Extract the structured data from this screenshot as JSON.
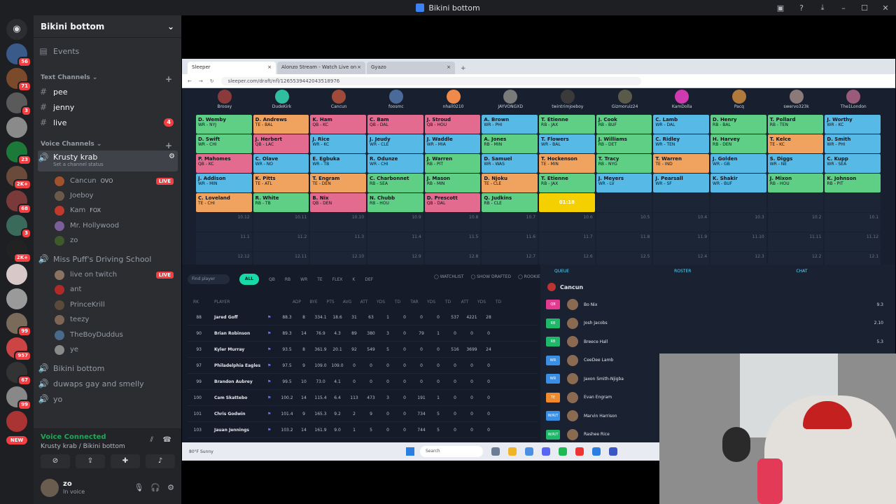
{
  "window": {
    "title": "Bikini bottom"
  },
  "rail": {
    "badges": [
      "56",
      "71",
      "3",
      "23",
      "2K+",
      "68",
      "3",
      "2K+",
      "99",
      "957",
      "67",
      "99"
    ],
    "new_label": "NEW"
  },
  "guild": {
    "name": "Bikini bottom"
  },
  "channels": {
    "events": "Events",
    "text_category": "Text Channels",
    "text": [
      {
        "name": "pee"
      },
      {
        "name": "jenny"
      },
      {
        "name": "live",
        "badge": "4"
      }
    ],
    "voice_category": "Voice Channels",
    "krusty": {
      "name": "Krusty krab",
      "status_hint": "Set a channel status",
      "users": [
        {
          "name": "Cancun",
          "extra": "OVO",
          "live": "LIVE",
          "color": "#a0522d"
        },
        {
          "name": "Joeboy",
          "color": "#6b5a4a"
        },
        {
          "name": "Kam",
          "extra": "FOX",
          "color": "#c0392b"
        },
        {
          "name": "Mr. Hollywood",
          "color": "#7b5e9a"
        },
        {
          "name": "zo",
          "color": "#3e5a2b"
        }
      ]
    },
    "puffs": {
      "name": "Miss Puff's Driving School",
      "users": [
        {
          "name": "live on twitch",
          "live": "LIVE",
          "color": "#8a7360"
        },
        {
          "name": "ant",
          "color": "#b02a2a"
        },
        {
          "name": "PrinceKrill",
          "color": "#5a4a3a"
        },
        {
          "name": "teezy",
          "color": "#7d6655"
        },
        {
          "name": "TheBoyDuddus",
          "color": "#4a6a8a"
        },
        {
          "name": "ye",
          "color": "#8a8a8a"
        }
      ]
    },
    "voice_more": [
      "Bikini bottom",
      "duwaps gay and smelly",
      "yo"
    ]
  },
  "voice_panel": {
    "title": "Voice Connected",
    "sub": "Krusty krab / Bikini bottom"
  },
  "user_panel": {
    "name": "zo",
    "status": "In voice"
  },
  "browser": {
    "tabs": [
      {
        "label": "Sleeper"
      },
      {
        "label": "Alonzo Stream - Watch Live on"
      },
      {
        "label": "Gyazo"
      }
    ],
    "url": "sleeper.com/draft/nfl/1265539442043518976"
  },
  "draft": {
    "teams": [
      "Brooxy",
      "DudeKirk",
      "Cancun",
      "foosmc",
      "nhall0210",
      "JAYVONGXD",
      "twintrimjoeboy",
      "Gizmoruiz24",
      "KamDolla",
      "Pacq",
      "swervo323k",
      "The1London"
    ],
    "rows": [
      [
        [
          "D. Wemby",
          "WR - NYJ",
          "rb"
        ],
        [
          "D. Andrews",
          "TE - BAL",
          "te"
        ],
        [
          "K. Ham",
          "QB - KC",
          "qb"
        ],
        [
          "C. Bam",
          "QB - DAL",
          "qb"
        ],
        [
          "J. Stroud",
          "QB - HOU",
          "qb"
        ],
        [
          "A. Brown",
          "WR - PHI",
          "wr"
        ],
        [
          "T. Etienne",
          "RB - JAX",
          "rb"
        ],
        [
          "J. Cook",
          "RB - BUF",
          "rb"
        ],
        [
          "C. Lamb",
          "WR - DAL",
          "wr"
        ],
        [
          "D. Henry",
          "RB - BAL",
          "rb"
        ],
        [
          "T. Pollard",
          "RB - TEN",
          "rb"
        ],
        [
          "J. Worthy",
          "WR - KC",
          "wr"
        ]
      ],
      [
        [
          "D. Swift",
          "WR - CHI",
          "rb"
        ],
        [
          "J. Herbert",
          "QB - LAC",
          "qb"
        ],
        [
          "J. Rice",
          "WR - KC",
          "wr"
        ],
        [
          "J. Jeudy",
          "WR - CLE",
          "wr"
        ],
        [
          "J. Waddle",
          "WR - MIA",
          "wr"
        ],
        [
          "A. Jones",
          "RB - MIN",
          "rb"
        ],
        [
          "T. Flowers",
          "WR - BAL",
          "wr"
        ],
        [
          "J. Williams",
          "RB - DET",
          "rb"
        ],
        [
          "C. Ridley",
          "WR - TEN",
          "wr"
        ],
        [
          "H. Harvey",
          "RB - DEN",
          "rb"
        ],
        [
          "T. Kelce",
          "TE - KC",
          "te"
        ],
        [
          "D. Smith",
          "WR - PHI",
          "wr"
        ]
      ],
      [
        [
          "P. Mahomes",
          "QB - KC",
          "qb"
        ],
        [
          "C. Olave",
          "WR - NO",
          "wr"
        ],
        [
          "E. Egbuka",
          "WR - TB",
          "wr"
        ],
        [
          "R. Odunze",
          "WR - CHI",
          "wr"
        ],
        [
          "J. Warren",
          "RB - PIT",
          "rb"
        ],
        [
          "D. Samuel",
          "WR - WAS",
          "wr"
        ],
        [
          "T. Hockenson",
          "TE - MIN",
          "te"
        ],
        [
          "T. Tracy",
          "RB - NYG",
          "rb"
        ],
        [
          "T. Warren",
          "TE - IND",
          "te"
        ],
        [
          "J. Golden",
          "WR - GB",
          "wr"
        ],
        [
          "S. Diggs",
          "WR - NE",
          "wr"
        ],
        [
          "C. Kupp",
          "WR - SEA",
          "wr"
        ]
      ],
      [
        [
          "J. Addison",
          "WR - MIN",
          "wr"
        ],
        [
          "K. Pitts",
          "TE - ATL",
          "te"
        ],
        [
          "T. Engram",
          "TE - DEN",
          "te"
        ],
        [
          "C. Charbonnet",
          "RB - SEA",
          "rb"
        ],
        [
          "J. Mason",
          "RB - MIN",
          "rb"
        ],
        [
          "D. Njoku",
          "TE - CLE",
          "te"
        ],
        [
          "T. Etienne",
          "RB - JAX",
          "rb"
        ],
        [
          "J. Meyers",
          "WR - LV",
          "wr"
        ],
        [
          "J. Pearsall",
          "WR - SF",
          "wr"
        ],
        [
          "K. Shakir",
          "WR - BUF",
          "wr"
        ],
        [
          "J. Mixon",
          "RB - HOU",
          "rb"
        ],
        [
          "K. Johnson",
          "RB - PIT",
          "rb"
        ]
      ],
      [
        [
          "C. Loveland",
          "TE - CHI",
          "te"
        ],
        [
          "R. White",
          "RB - TB",
          "rb"
        ],
        [
          "B. Nix",
          "QB - DEN",
          "qb"
        ],
        [
          "N. Chubb",
          "RB - HOU",
          "rb"
        ],
        [
          "D. Prescott",
          "QB - DAL",
          "qb"
        ],
        [
          "Q. Judkins",
          "RB - CLE",
          "rb"
        ],
        [
          "01:18",
          "",
          "timer"
        ],
        [
          "",
          "",
          ""
        ],
        [
          "",
          "",
          ""
        ],
        [
          "",
          "",
          ""
        ],
        [
          "",
          "",
          ""
        ],
        [
          "",
          "",
          ""
        ]
      ]
    ],
    "empty_pick_labels": [
      [
        "10.12",
        "10.11",
        "10.10",
        "10.9",
        "10.8",
        "10.7",
        "10.6",
        "10.5",
        "10.4",
        "10.3",
        "10.2",
        "10.1"
      ],
      [
        "11.1",
        "11.2",
        "11.3",
        "11.4",
        "11.5",
        "11.6",
        "11.7",
        "11.8",
        "11.9",
        "11.10",
        "11.11",
        "11.12"
      ],
      [
        "12.12",
        "12.11",
        "12.10",
        "12.9",
        "12.8",
        "12.7",
        "12.6",
        "12.5",
        "12.4",
        "12.3",
        "12.2",
        "12.1"
      ]
    ]
  },
  "players": {
    "search_placeholder": "Find player",
    "filters": [
      "ALL",
      "QB",
      "RB",
      "WR",
      "TE",
      "FLEX",
      "K",
      "DEF"
    ],
    "toggles": [
      "WATCHLIST",
      "SHOW DRAFTED",
      "ROOKIES ONLY"
    ],
    "headers": [
      "RK",
      "PLAYER",
      "ADP",
      "BYE",
      "PTS",
      "AVG",
      "ATT",
      "YDS",
      "TD",
      "TAR",
      "YDS",
      "TD",
      "ATT",
      "YDS",
      "TD"
    ],
    "rows": [
      {
        "rk": "88",
        "name": "Jared Goff",
        "vals": [
          "88.3",
          "8",
          "334.1",
          "18.6",
          "31",
          "63",
          "1",
          "0",
          "0",
          "0",
          "537",
          "4221",
          "28"
        ]
      },
      {
        "rk": "90",
        "name": "Brian Robinson",
        "vals": [
          "89.3",
          "14",
          "76.9",
          "4.3",
          "89",
          "380",
          "3",
          "0",
          "79",
          "1",
          "0",
          "0",
          "0"
        ]
      },
      {
        "rk": "93",
        "name": "Kyler Murray",
        "vals": [
          "93.5",
          "8",
          "361.9",
          "20.1",
          "92",
          "549",
          "5",
          "0",
          "0",
          "0",
          "516",
          "3699",
          "24"
        ]
      },
      {
        "rk": "97",
        "name": "Philadelphia Eagles",
        "vals": [
          "97.5",
          "9",
          "109.0",
          "109.0",
          "0",
          "0",
          "0",
          "0",
          "0",
          "0",
          "0",
          "0",
          "0"
        ]
      },
      {
        "rk": "99",
        "name": "Brandon Aubrey",
        "vals": [
          "99.5",
          "10",
          "73.0",
          "4.1",
          "0",
          "0",
          "0",
          "0",
          "0",
          "0",
          "0",
          "0",
          "0"
        ]
      },
      {
        "rk": "100",
        "name": "Cam Skattebo",
        "vals": [
          "100.2",
          "14",
          "115.4",
          "6.4",
          "113",
          "473",
          "3",
          "0",
          "191",
          "1",
          "0",
          "0",
          "0"
        ]
      },
      {
        "rk": "101",
        "name": "Chris Godwin",
        "vals": [
          "101.4",
          "9",
          "165.3",
          "9.2",
          "2",
          "9",
          "0",
          "0",
          "734",
          "5",
          "0",
          "0",
          "0"
        ]
      },
      {
        "rk": "103",
        "name": "Jauan Jennings",
        "vals": [
          "103.2",
          "14",
          "161.9",
          "9.0",
          "1",
          "5",
          "0",
          "0",
          "744",
          "5",
          "0",
          "0",
          "0"
        ]
      }
    ]
  },
  "queue": {
    "tabs": [
      "QUEUE",
      "ROSTER",
      "CHAT"
    ],
    "owner": "Cancun",
    "items": [
      {
        "pos": "QB",
        "name": "Bo Nix",
        "val": "9.3",
        "color": "#e33a8f"
      },
      {
        "pos": "RB",
        "name": "Josh Jacobs",
        "val": "2.10",
        "color": "#1fb86a"
      },
      {
        "pos": "RB",
        "name": "Breece Hall",
        "val": "5.3",
        "color": "#1fb86a"
      },
      {
        "pos": "WR",
        "name": "CeeDee Lamb",
        "val": "",
        "color": "#3a8ee3"
      },
      {
        "pos": "WR",
        "name": "Jaxon Smith-Njigba",
        "val": "",
        "color": "#3a8ee3"
      },
      {
        "pos": "TE",
        "name": "Evan Engram",
        "val": "",
        "color": "#f08a2a"
      },
      {
        "pos": "W/R/T",
        "name": "Marvin Harrison",
        "val": "",
        "color": "#3a8ee3"
      },
      {
        "pos": "W/R/T",
        "name": "Rashee Rice",
        "val": "",
        "color": "#1fb86a"
      }
    ]
  },
  "taskbar": {
    "weather": "80°F Sunny",
    "search": "Search"
  }
}
